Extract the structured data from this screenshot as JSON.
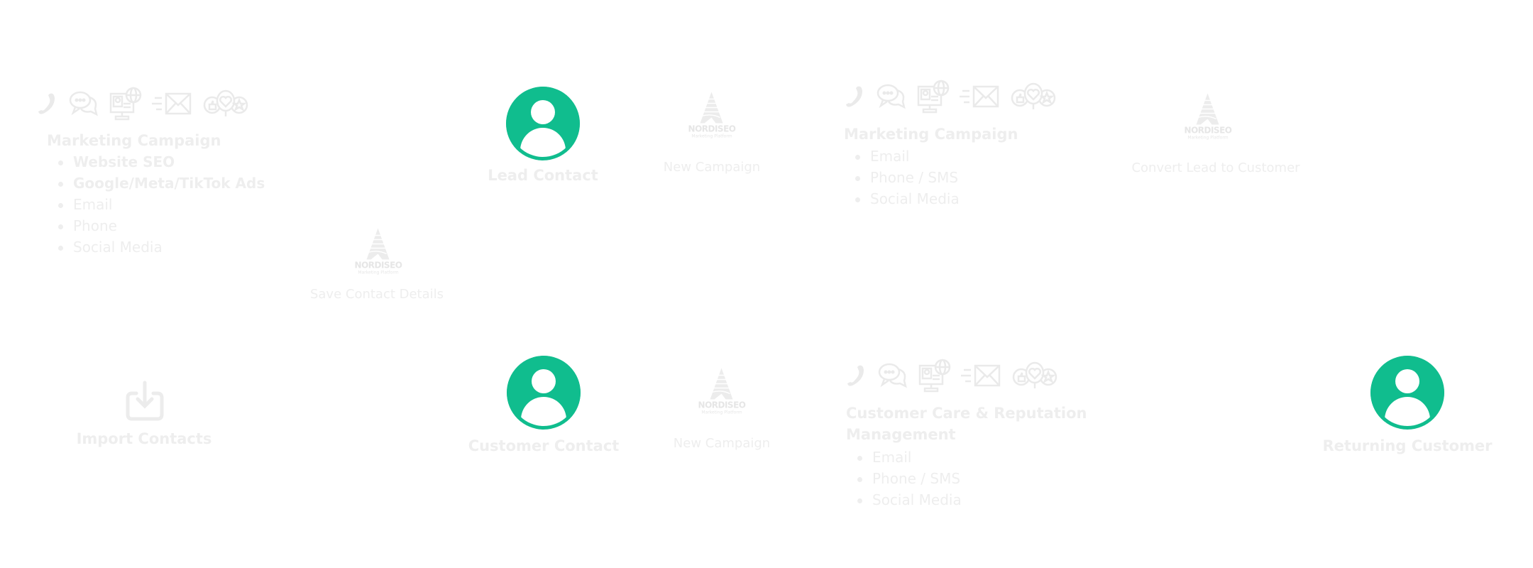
{
  "colors": {
    "accent": "#10bd8e",
    "text": "#eeeeee"
  },
  "channel_icons": [
    "phone-icon",
    "chat-icon",
    "web-monitor-icon",
    "email-icon",
    "reviews-icon"
  ],
  "logo": {
    "name": "NORDISEO",
    "tagline": "Marketing Platform"
  },
  "campaign1": {
    "title": "Marketing Campaign",
    "items": [
      "Website SEO",
      "Google/Meta/TikTok Ads",
      "Email",
      "Phone",
      "Social Media"
    ]
  },
  "lead_contact": {
    "label": "Lead Contact"
  },
  "new_campaign_1": {
    "label": "New Campaign"
  },
  "campaign2": {
    "title": "Marketing Campaign",
    "items": [
      "Email",
      "Phone / SMS",
      "Social Media"
    ]
  },
  "convert": {
    "label": "Convert Lead to Customer"
  },
  "save_contact": {
    "label": "Save Contact Details"
  },
  "import_contacts": {
    "label": "Import Contacts"
  },
  "customer_contact": {
    "label": "Customer Contact"
  },
  "new_campaign_2": {
    "label": "New Campaign"
  },
  "campaign3": {
    "title_line1": "Customer Care & Reputation",
    "title_line2": "Management",
    "items": [
      "Email",
      "Phone / SMS",
      "Social Media"
    ]
  },
  "returning_customer": {
    "label": "Returning Customer"
  }
}
